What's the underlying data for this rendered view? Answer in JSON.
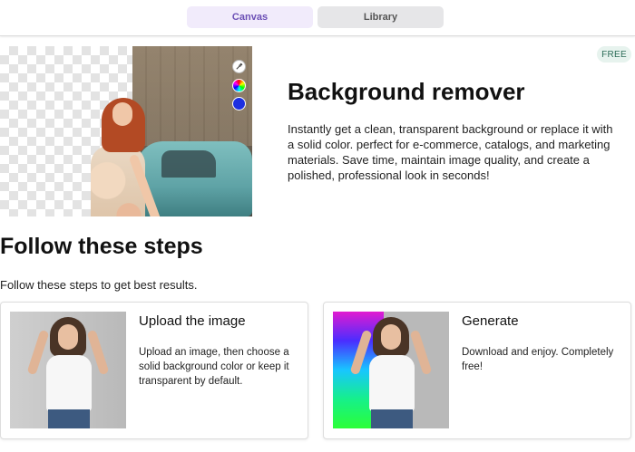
{
  "tabs": [
    {
      "label": "Canvas",
      "active": true
    },
    {
      "label": "Library",
      "active": false
    }
  ],
  "hero": {
    "badge": "FREE",
    "title": "Background remover",
    "description": "Instantly get a clean, transparent background or replace it with a solid color. perfect for e-commerce, catalogs, and marketing materials. Save time, maintain image quality, and create a polished, professional look in seconds!",
    "tools": [
      "eyedropper-icon",
      "color-wheel-icon",
      "blue-swatch"
    ]
  },
  "steps": {
    "title": "Follow these steps",
    "subtitle": "Follow these steps to get best results.",
    "cards": [
      {
        "title": "Upload the image",
        "description": "Upload an image, then choose a solid background color or keep it transparent by default."
      },
      {
        "title": "Generate",
        "description": "Download and enjoy. Completely free!"
      }
    ]
  },
  "colors": {
    "accent": "#6b4fb5",
    "tab_active_bg": "#f1ebfb",
    "badge_bg": "#e7f3ee",
    "swatch_blue": "#1d2fe0"
  }
}
